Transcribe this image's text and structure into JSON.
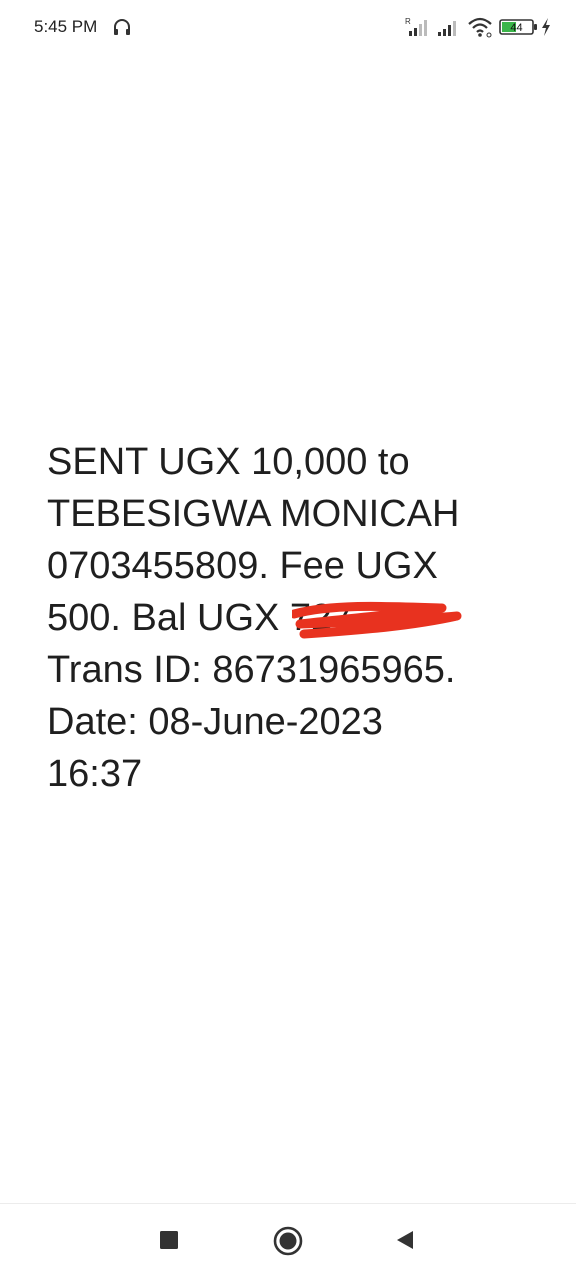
{
  "status_bar": {
    "time": "5:45 PM",
    "battery_level": "44",
    "icons": [
      "headset-icon",
      "signal-icon",
      "signal-icon",
      "wifi-icon",
      "battery-icon",
      "charging-icon"
    ],
    "roaming_indicator": "R"
  },
  "message": {
    "lines": [
      "SENT UGX 10,000 to",
      "TEBESIGWA MONICAH",
      "0703455809. Fee UGX",
      "500. Bal UGX ",
      "Trans ID: 86731965965.",
      "Date: 08-June-2023",
      "16:37"
    ],
    "redacted_balance_visible": "727.",
    "redaction_color": "#e8321f"
  },
  "nav_bar": {
    "buttons": [
      "recents-icon",
      "home-icon",
      "back-icon"
    ]
  }
}
